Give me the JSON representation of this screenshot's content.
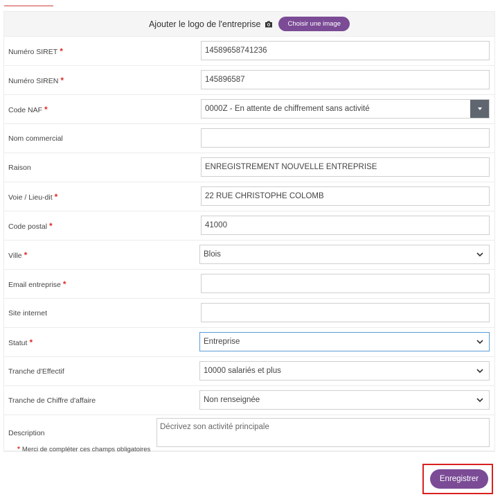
{
  "logo": {
    "label": "Ajouter le logo de l'entreprise",
    "button": "Choisir une image"
  },
  "fields": {
    "siret": {
      "label": "Numéro SIRET",
      "value": "14589658741236"
    },
    "siren": {
      "label": "Numéro SIREN",
      "value": "145896587"
    },
    "naf": {
      "label": "Code NAF",
      "value": "0000Z - En attente de chiffrement sans activité"
    },
    "nom": {
      "label": "Nom commercial",
      "value": ""
    },
    "raison": {
      "label": "Raison",
      "value": "ENREGISTREMENT NOUVELLE ENTREPRISE"
    },
    "voie": {
      "label": "Voie / Lieu-dit",
      "value": "22 RUE CHRISTOPHE COLOMB"
    },
    "cp": {
      "label": "Code postal",
      "value": "41000"
    },
    "ville": {
      "label": "Ville",
      "value": "Blois"
    },
    "email": {
      "label": "Email entreprise",
      "value": ""
    },
    "site": {
      "label": "Site internet",
      "value": ""
    },
    "statut": {
      "label": "Statut",
      "value": "Entreprise"
    },
    "effectif": {
      "label": "Tranche d'Effectif",
      "value": "10000 salariés et plus"
    },
    "ca": {
      "label": "Tranche de Chiffre d'affaire",
      "value": "Non renseignée"
    },
    "description": {
      "label": "Description",
      "placeholder": "Décrivez son activité principale"
    }
  },
  "required_mark": "*",
  "note": "Merci de compléter ces champs obligatoires",
  "save_label": "Enregistrer",
  "colors": {
    "accent": "#7b4b96",
    "required": "#e02b27",
    "highlight": "#d9201f"
  }
}
